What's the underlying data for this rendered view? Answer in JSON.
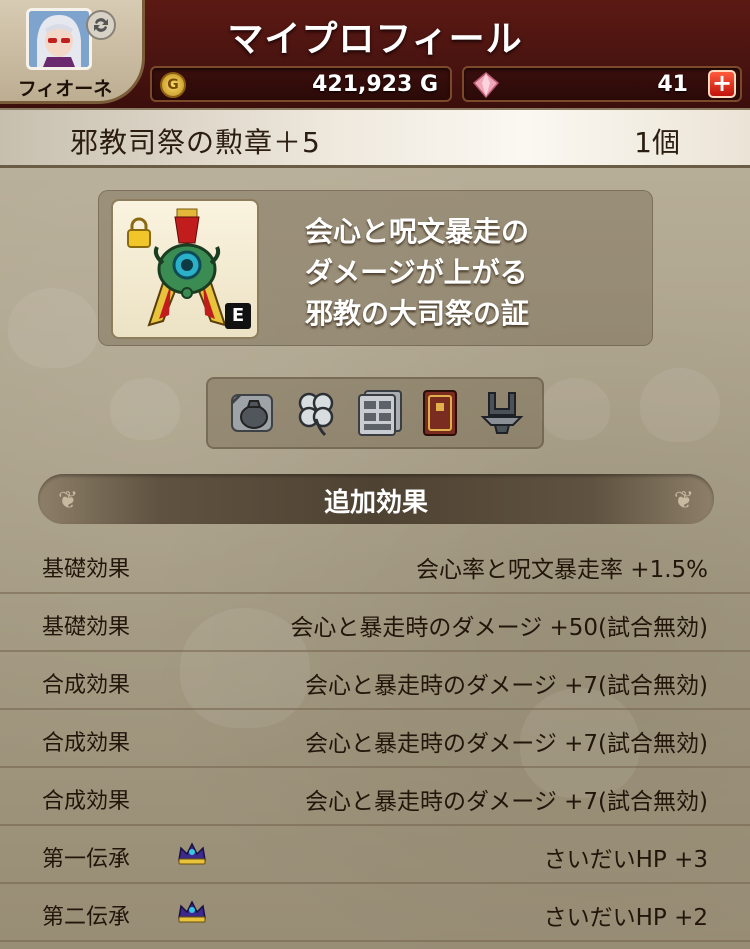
{
  "header": {
    "title": "マイプロフィール",
    "player_name": "フィオーネ",
    "gold": "421,923 G",
    "gems": "41"
  },
  "item": {
    "name": "邪教司祭の勲章＋5",
    "count": "1個",
    "description": [
      "会心と呪文暴走の",
      "ダメージが上がる",
      "邪教の大司祭の証"
    ],
    "equip_badge": "E"
  },
  "tool_icons": [
    "bag-icon",
    "clover-icon",
    "drawer-icon",
    "book-icon",
    "anvil-icon"
  ],
  "section": {
    "title": "追加効果"
  },
  "effects": [
    {
      "label": "基礎効果",
      "value": "会心率と呪文暴走率 +1.5%"
    },
    {
      "label": "基礎効果",
      "value": "会心と暴走時のダメージ +50(試合無効)"
    },
    {
      "label": "合成効果",
      "value": "会心と暴走時のダメージ +7(試合無効)"
    },
    {
      "label": "合成効果",
      "value": "会心と暴走時のダメージ +7(試合無効)"
    },
    {
      "label": "合成効果",
      "value": "会心と暴走時のダメージ +7(試合無効)"
    },
    {
      "label": "第一伝承",
      "value": "さいだいHP +3",
      "icon": "crown-icon"
    },
    {
      "label": "第二伝承",
      "value": "さいだいHP +2",
      "icon": "crown-icon"
    }
  ],
  "colors": {
    "header_bg": "#4a1410",
    "parchment": "#a99f8a",
    "plus_button": "#d4261a"
  }
}
